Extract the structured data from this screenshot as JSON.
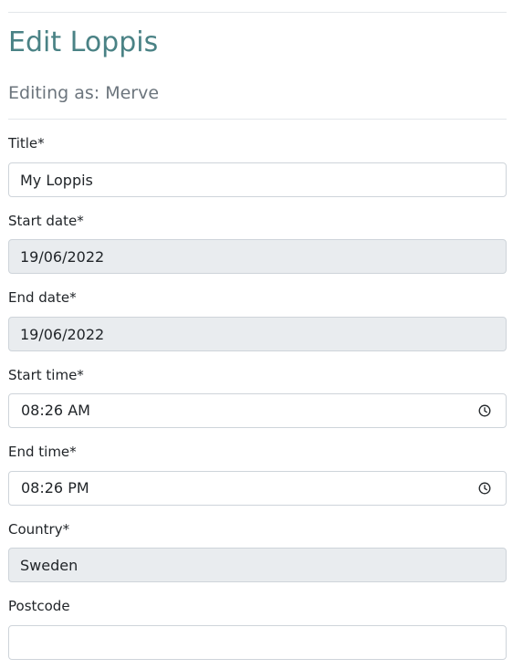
{
  "header": {
    "title": "Edit Loppis",
    "subtitle": "Editing as: Merve"
  },
  "form": {
    "title": {
      "label": "Title*",
      "value": "My Loppis"
    },
    "start_date": {
      "label": "Start date*",
      "value": "19/06/2022"
    },
    "end_date": {
      "label": "End date*",
      "value": "19/06/2022"
    },
    "start_time": {
      "label": "Start time*",
      "value": "08:26 AM",
      "icon": "clock-icon"
    },
    "end_time": {
      "label": "End time*",
      "value": "08:26 PM",
      "icon": "clock-icon"
    },
    "country": {
      "label": "Country*",
      "value": "Sweden"
    },
    "postcode": {
      "label": "Postcode",
      "value": ""
    }
  },
  "colors": {
    "title": "#4a8285",
    "subtitle": "#6c757d",
    "readonly_bg": "#e9ecef",
    "border": "#ced4da"
  }
}
